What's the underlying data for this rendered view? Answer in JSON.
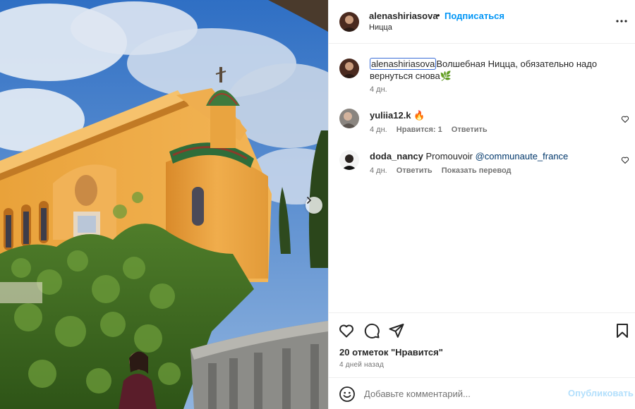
{
  "post": {
    "author": "alenashiriasova",
    "dot": "•",
    "follow_label": "Подписаться",
    "location": "Ницца",
    "photo_subject": "yellow chapel with tiled dome and ivy-covered wall under a cloudy blue sky"
  },
  "caption": {
    "username": "alenashiriasova",
    "text": "Волшебная Ницца, обязательно надо вернуться снова🌿",
    "time": "4 дн."
  },
  "comments": [
    {
      "username": "yuliia12.k",
      "text": "🔥",
      "time": "4 дн.",
      "likes": "Нравится: 1",
      "reply": "Ответить",
      "heart_icon": "heart-outline-icon"
    },
    {
      "username": "doda_nancy",
      "text": "Promouvoir",
      "mention": "@communaute_france",
      "time": "4 дн.",
      "reply": "Ответить",
      "translate": "Показать перевод",
      "heart_icon": "heart-outline-icon"
    }
  ],
  "actions": {
    "icons": [
      "heart-icon",
      "comment-icon",
      "share-icon",
      "bookmark-icon"
    ],
    "likes_label": "20 отметок \"Нравится\"",
    "posted": "4 дней назад"
  },
  "composer": {
    "placeholder": "Добавьте комментарий...",
    "publish_label": "Опубликовать"
  },
  "colors": {
    "accent": "#0095f6",
    "publish_disabled": "#b2dffc",
    "mention": "#00376b",
    "muted": "#737373"
  }
}
